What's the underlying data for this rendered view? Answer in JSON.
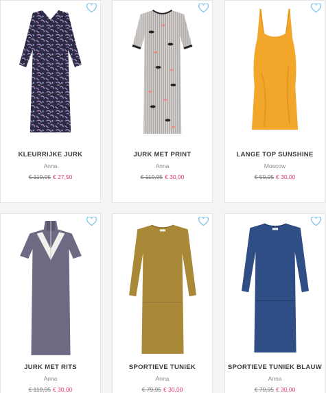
{
  "accent_color": "#e0356b",
  "heart_color": "#7ec4ea",
  "products": [
    {
      "name": "KLEURRIJKE JURK",
      "brand": "Anna",
      "old_price": "€ 119,95",
      "new_price": "€ 27,50",
      "image": "floral-dress",
      "icon": "heart-icon"
    },
    {
      "name": "JURK MET PRINT",
      "brand": "Anna",
      "old_price": "€ 119,95",
      "new_price": "€ 30,00",
      "image": "print-dress",
      "icon": "heart-icon"
    },
    {
      "name": "LANGE TOP SUNSHINE",
      "brand": "Moscow",
      "old_price": "€ 59,95",
      "new_price": "€ 30,00",
      "image": "yellow-slip-dress",
      "icon": "heart-icon"
    },
    {
      "name": "JURK MET RITS",
      "brand": "Anna",
      "old_price": "€ 119,95",
      "new_price": "€ 30,00",
      "image": "zip-dress",
      "icon": "heart-icon"
    },
    {
      "name": "SPORTIEVE TUNIEK",
      "brand": "Anna",
      "old_price": "€ 79,95",
      "new_price": "€ 30,00",
      "image": "camel-tunic",
      "icon": "heart-icon"
    },
    {
      "name": "SPORTIEVE TUNIEK BLAUW",
      "brand": "Anna",
      "old_price": "€ 79,95",
      "new_price": "€ 30,00",
      "image": "blue-tunic",
      "icon": "heart-icon"
    }
  ]
}
